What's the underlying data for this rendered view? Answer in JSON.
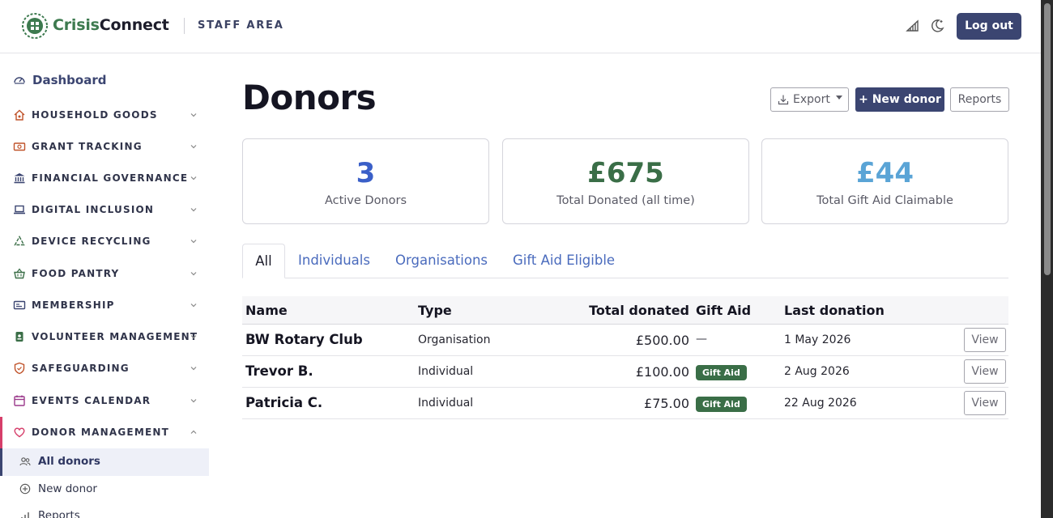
{
  "header": {
    "brand_part1": "Crisis",
    "brand_part2": "Connect",
    "area_label": "STAFF AREA",
    "icons": [
      "signal-icon",
      "theme-toggle-icon"
    ],
    "logout_label": "Log out"
  },
  "sidebar": {
    "dashboard_label": "Dashboard",
    "items": [
      {
        "label": "HOUSEHOLD GOODS",
        "icon": "home-icon",
        "icon_color": "#c0532a"
      },
      {
        "label": "GRANT TRACKING",
        "icon": "money-icon",
        "icon_color": "#c0532a"
      },
      {
        "label": "FINANCIAL GOVERNANCE",
        "icon": "bank-icon",
        "icon_color": "#3b4571"
      },
      {
        "label": "DIGITAL INCLUSION",
        "icon": "laptop-icon",
        "icon_color": "#3b4571"
      },
      {
        "label": "DEVICE RECYCLING",
        "icon": "recycle-icon",
        "icon_color": "#3a6e47"
      },
      {
        "label": "FOOD PANTRY",
        "icon": "basket-icon",
        "icon_color": "#3a6e47"
      },
      {
        "label": "MEMBERSHIP",
        "icon": "id-card-icon",
        "icon_color": "#3b4571"
      },
      {
        "label": "VOLUNTEER MANAGEMENT",
        "icon": "badge-icon",
        "icon_color": "#3a6e47"
      },
      {
        "label": "SAFEGUARDING",
        "icon": "shield-icon",
        "icon_color": "#c0532a"
      },
      {
        "label": "EVENTS CALENDAR",
        "icon": "calendar-icon",
        "icon_color": "#9b3a8c"
      },
      {
        "label": "DONOR MANAGEMENT",
        "icon": "heart-icon",
        "icon_color": "#d63e6a"
      }
    ],
    "subitems": [
      {
        "label": "All donors",
        "icon": "people-icon"
      },
      {
        "label": "New donor",
        "icon": "plus-circle-icon"
      },
      {
        "label": "Reports",
        "icon": "chart-icon"
      }
    ]
  },
  "main": {
    "title": "Donors",
    "export_label": "Export",
    "new_donor_label": "+ New donor",
    "reports_label": "Reports",
    "stats": [
      {
        "value": "3",
        "caption": "Active Donors",
        "color": "#3a5fc8"
      },
      {
        "value": "£675",
        "caption": "Total Donated (all time)",
        "color": "#3a6e47"
      },
      {
        "value": "£44",
        "caption": "Total Gift Aid Claimable",
        "color": "#5aa4d6"
      }
    ],
    "tabs": [
      "All",
      "Individuals",
      "Organisations",
      "Gift Aid Eligible"
    ],
    "table": {
      "headers": [
        "Name",
        "Type",
        "Total donated",
        "Gift Aid",
        "Last donation"
      ],
      "rows": [
        {
          "name": "BW Rotary Club",
          "type": "Organisation",
          "total": "£500.00",
          "gift_aid": "—",
          "last": "1 May 2026",
          "action": "View"
        },
        {
          "name": "Trevor B.",
          "type": "Individual",
          "total": "£100.00",
          "gift_aid": "Gift Aid",
          "last": "2 Aug 2026",
          "action": "View"
        },
        {
          "name": "Patricia C.",
          "type": "Individual",
          "total": "£75.00",
          "gift_aid": "Gift Aid",
          "last": "22 Aug 2026",
          "action": "View"
        }
      ]
    }
  }
}
